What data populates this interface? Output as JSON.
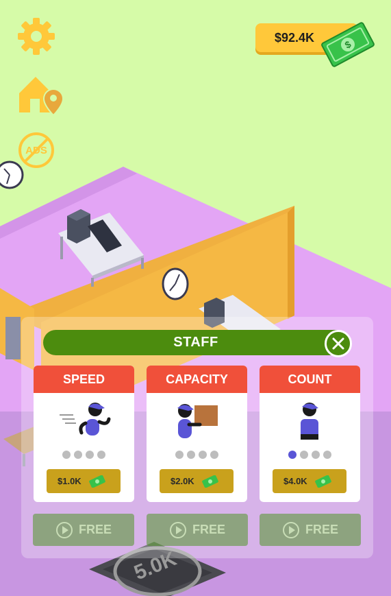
{
  "hud": {
    "money": "$92.4K",
    "ads_label": "ADS"
  },
  "panel": {
    "title": "STAFF",
    "cards": [
      {
        "label": "SPEED",
        "price": "$1.0K",
        "free_label": "FREE",
        "level": 0,
        "max_level": 4
      },
      {
        "label": "CAPACITY",
        "price": "$2.0K",
        "free_label": "FREE",
        "level": 0,
        "max_level": 4
      },
      {
        "label": "COUNT",
        "price": "$4.0K",
        "free_label": "FREE",
        "level": 1,
        "max_level": 4
      }
    ]
  },
  "pad": {
    "label": "5.0K"
  },
  "colors": {
    "accent_yellow": "#ffc83a",
    "panel_green": "#4c8c0e",
    "card_red": "#f0503a",
    "level_on": "#5a55d6",
    "floor_purple": "#e3a5f5",
    "wall_orange": "#f5b844"
  }
}
